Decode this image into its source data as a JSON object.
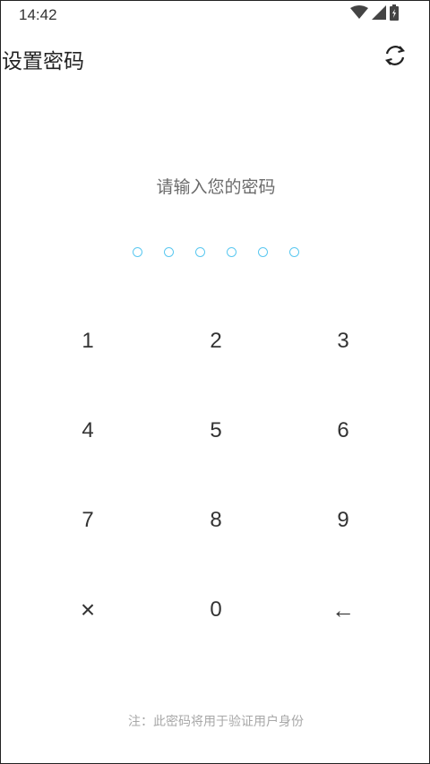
{
  "status_bar": {
    "time": "14:42",
    "icons": [
      "wifi-icon",
      "signal-icon",
      "battery-icon"
    ]
  },
  "header": {
    "title": "设置密码",
    "refresh_icon": "refresh-icon"
  },
  "prompt": "请输入您的密码",
  "pin_length": 6,
  "keypad": {
    "keys": [
      "1",
      "2",
      "3",
      "4",
      "5",
      "6",
      "7",
      "8",
      "9",
      "×",
      "0",
      "←"
    ]
  },
  "note": "注：此密码将用于验证用户身份",
  "colors": {
    "dot_accent": "#5ac8f0",
    "text_primary": "#333333",
    "text_secondary": "#6b6b6b",
    "text_hint": "#a8a8a8"
  }
}
